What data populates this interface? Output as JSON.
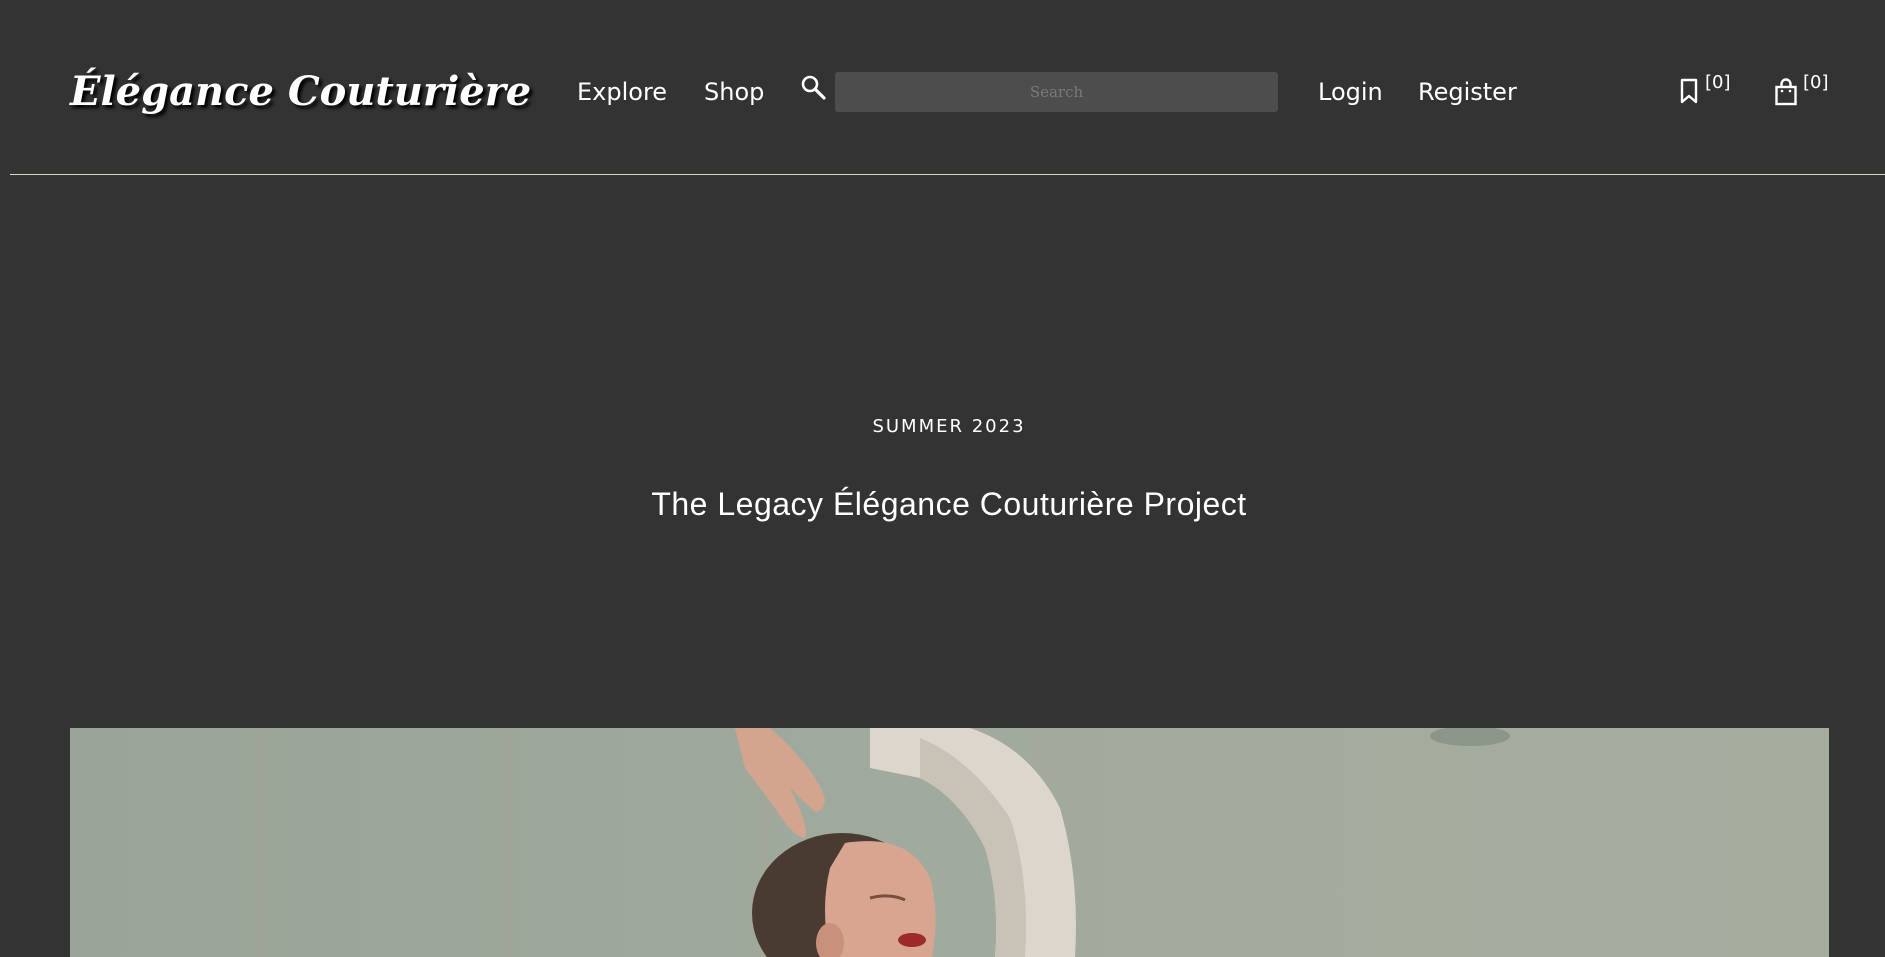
{
  "brand": {
    "logo_text": "Élégance Couturière"
  },
  "nav": {
    "explore_label": "Explore",
    "shop_label": "Shop",
    "login_label": "Login",
    "register_label": "Register"
  },
  "search": {
    "placeholder": "Search",
    "value": "",
    "icon": "search-icon"
  },
  "counters": {
    "bookmarks": {
      "icon": "bookmark-icon",
      "text": "[0]"
    },
    "cart": {
      "icon": "shopping-bag-icon",
      "text": "[0]"
    }
  },
  "hero": {
    "season": "SUMMER 2023",
    "title": "The Legacy Élégance Couturière Project"
  },
  "colors": {
    "background": "#333333",
    "text": "#ffffff",
    "search_bg": "#4d4d4d",
    "divider": "#d8d8c4",
    "photo_backdrop": "#9fa89c"
  }
}
